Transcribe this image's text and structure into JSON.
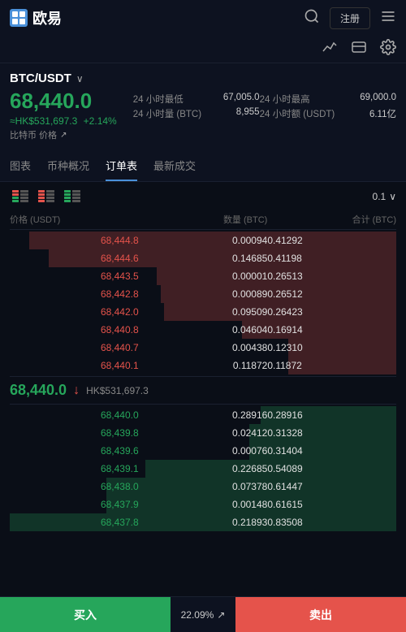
{
  "header": {
    "logo_text": "欧易",
    "search_icon": "🔍",
    "register_label": "注册",
    "menu_icon": "☰"
  },
  "subheader": {
    "chart_icon": "📈",
    "card_icon": "🃏",
    "settings_icon": "⚙"
  },
  "ticker": {
    "pair": "BTC/USDT",
    "price": "68,440.0",
    "hk_price": "≈HK$531,697.3",
    "change_pct": "+2.14%",
    "label": "比特币 价格",
    "stats": [
      {
        "label": "24 小时最低",
        "value": "67,005.0"
      },
      {
        "label": "24 小时最高",
        "value": "69,000.0"
      },
      {
        "label": "24 小时量 (BTC)",
        "value": "8,955"
      },
      {
        "label": "24 小时额 (USDT)",
        "value": "6.11亿"
      }
    ]
  },
  "tabs": [
    {
      "label": "图表",
      "active": false
    },
    {
      "label": "币种概况",
      "active": false
    },
    {
      "label": "订单表",
      "active": true
    },
    {
      "label": "最新成交",
      "active": false
    }
  ],
  "orderbook": {
    "decimals_label": "0.1",
    "col_headers": [
      "价格 (USDT)",
      "数量 (BTC)",
      "合计 (BTC)"
    ],
    "sell_orders": [
      {
        "price": "68,444.8",
        "qty": "0.00094",
        "total": "0.41292",
        "bar_pct": 95
      },
      {
        "price": "68,444.6",
        "qty": "0.14685",
        "total": "0.41198",
        "bar_pct": 90
      },
      {
        "price": "68,443.5",
        "qty": "0.00001",
        "total": "0.26513",
        "bar_pct": 62
      },
      {
        "price": "68,442.8",
        "qty": "0.00089",
        "total": "0.26512",
        "bar_pct": 61
      },
      {
        "price": "68,442.0",
        "qty": "0.09509",
        "total": "0.26423",
        "bar_pct": 60
      },
      {
        "price": "68,440.8",
        "qty": "0.04604",
        "total": "0.16914",
        "bar_pct": 40
      },
      {
        "price": "68,440.7",
        "qty": "0.00438",
        "total": "0.12310",
        "bar_pct": 28
      },
      {
        "price": "68,440.1",
        "qty": "0.11872",
        "total": "0.11872",
        "bar_pct": 28
      }
    ],
    "mid_price": "68,440.0",
    "mid_price_hk": "HK$531,697.3",
    "mid_price_down": true,
    "buy_orders": [
      {
        "price": "68,440.0",
        "qty": "0.28916",
        "total": "0.28916",
        "bar_pct": 35
      },
      {
        "price": "68,439.8",
        "qty": "0.02412",
        "total": "0.31328",
        "bar_pct": 38
      },
      {
        "price": "68,439.6",
        "qty": "0.00076",
        "total": "0.31404",
        "bar_pct": 38
      },
      {
        "price": "68,439.1",
        "qty": "0.22685",
        "total": "0.54089",
        "bar_pct": 65
      },
      {
        "price": "68,438.0",
        "qty": "0.07378",
        "total": "0.61447",
        "bar_pct": 75
      },
      {
        "price": "68,437.9",
        "qty": "0.00148",
        "total": "0.61615",
        "bar_pct": 75
      },
      {
        "price": "68,437.8",
        "qty": "0.21893",
        "total": "0.83508",
        "bar_pct": 100
      }
    ]
  },
  "bottom": {
    "buy_label": "买入",
    "sell_label": "卖出",
    "pct_label": "22.09%"
  }
}
